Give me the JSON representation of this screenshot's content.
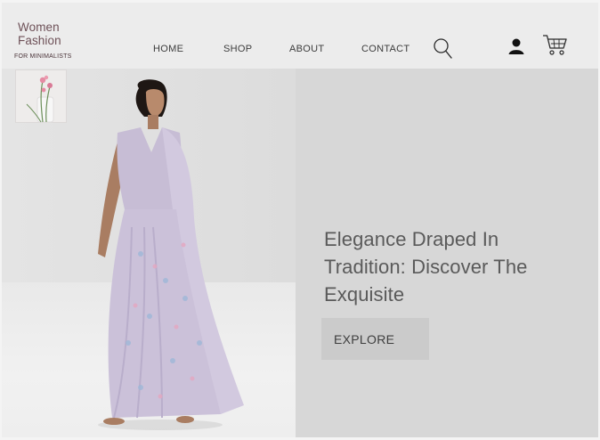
{
  "brand": {
    "line1": "Women",
    "line2": "Fashion",
    "tagline": "FOR MINIMALISTS"
  },
  "nav": {
    "home": "HOME",
    "shop": "SHOP",
    "about": "ABOUT",
    "contact": "CONTACT"
  },
  "icons": {
    "search": "search-icon",
    "account": "user-icon",
    "cart": "cart-icon"
  },
  "hero": {
    "headline_line1": "Elegance Draped In",
    "headline_line2": "Tradition: Discover The",
    "headline_line3": "Exquisite",
    "cta_label": "EXPLORE"
  },
  "colors": {
    "header_bg": "#ececec",
    "hero_bg": "#d7d7d7",
    "button_bg": "#cbcbcb",
    "brand_text": "#6e5158",
    "saree": "#c9bfd6"
  }
}
